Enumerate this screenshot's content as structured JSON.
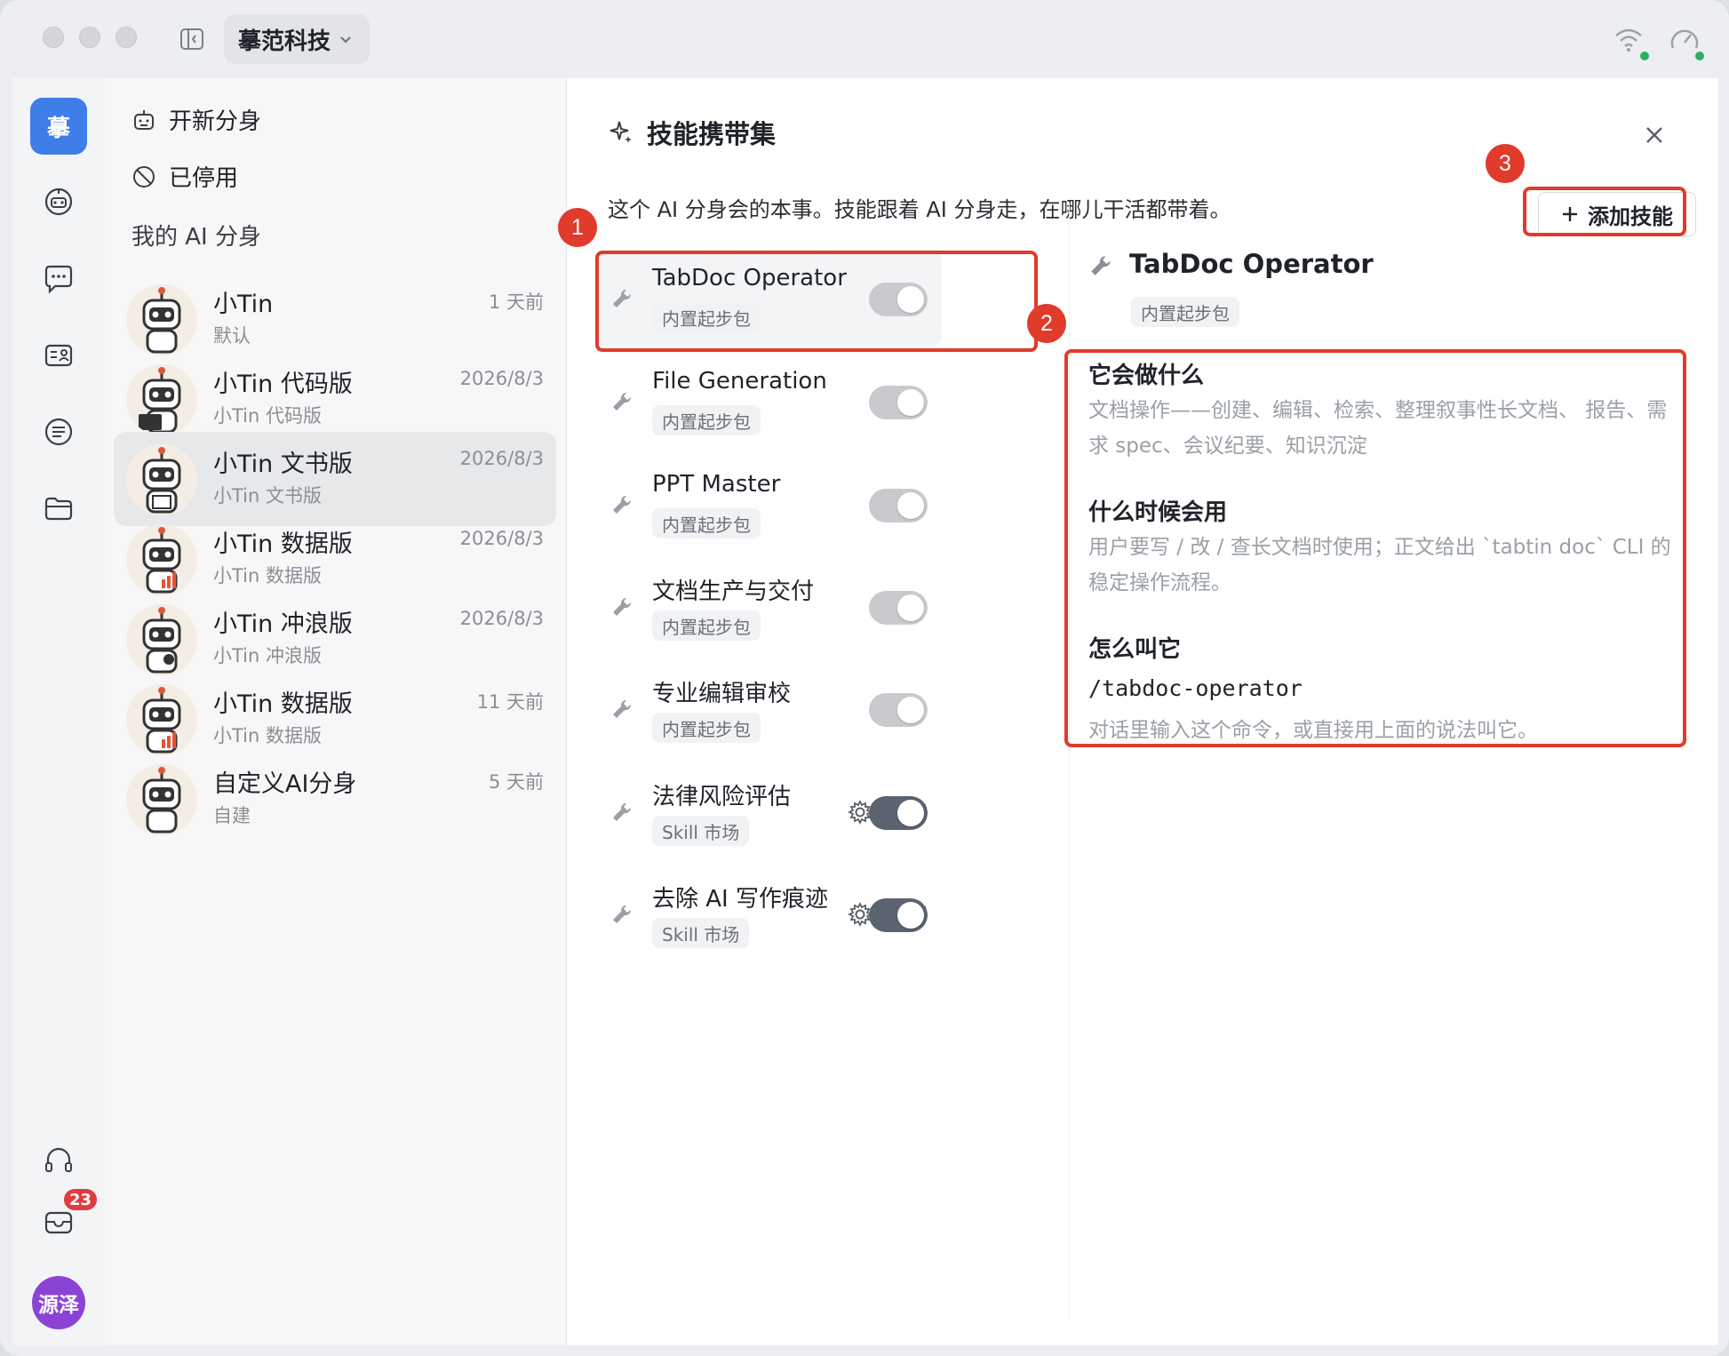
{
  "titlebar": {
    "workspace": "摹范科技"
  },
  "rail": {
    "logo_text": "摹",
    "mail_badge": "23",
    "user_avatar_text": "源泽"
  },
  "sidebar": {
    "new_agent": "开新分身",
    "disabled": "已停用",
    "section_title": "我的 AI 分身",
    "agents": [
      {
        "name": "小Tin",
        "sub": "默认",
        "time": "1 天前"
      },
      {
        "name": "小Tin 代码版",
        "sub": "小Tin 代码版",
        "time": "2026/8/3"
      },
      {
        "name": "小Tin 文书版",
        "sub": "小Tin 文书版",
        "time": "2026/8/3"
      },
      {
        "name": "小Tin 数据版",
        "sub": "小Tin 数据版",
        "time": "2026/8/3"
      },
      {
        "name": "小Tin 冲浪版",
        "sub": "小Tin 冲浪版",
        "time": "2026/8/3"
      },
      {
        "name": "小Tin 数据版",
        "sub": "小Tin 数据版",
        "time": "11 天前"
      },
      {
        "name": "自定义AI分身",
        "sub": "自建",
        "time": "5 天前"
      }
    ]
  },
  "panel": {
    "title": "技能携带集",
    "description": "这个 AI 分身会的本事。技能跟着 AI 分身走，在哪儿干活都带着。",
    "add_button": "添加技能",
    "skills": [
      {
        "name": "TabDoc Operator",
        "tag": "内置起步包",
        "enabled": true
      },
      {
        "name": "File Generation",
        "tag": "内置起步包",
        "enabled": true
      },
      {
        "name": "PPT Master",
        "tag": "内置起步包",
        "enabled": true
      },
      {
        "name": "文档生产与交付",
        "tag": "内置起步包",
        "enabled": true
      },
      {
        "name": "专业编辑审校",
        "tag": "内置起步包",
        "enabled": true
      },
      {
        "name": "法律风险评估",
        "tag": "Skill 市场",
        "enabled": true
      },
      {
        "name": "去除 AI 写作痕迹",
        "tag": "Skill 市场",
        "enabled": true
      }
    ],
    "detail": {
      "title": "TabDoc Operator",
      "tag": "内置起步包",
      "what_heading": "它会做什么",
      "what_text": "文档操作——创建、编辑、检索、整理叙事性长文档、 报告、需求 spec、会议纪要、知识沉淀",
      "when_heading": "什么时候会用",
      "when_text": "用户要写 / 改 / 查长文档时使用；正文给出 `tabtin doc` CLI 的稳定操作流程。",
      "how_heading": "怎么叫它",
      "command": "/tabdoc-operator",
      "how_text": "对话里输入这个命令，或直接用上面的说法叫它。"
    }
  },
  "annotations": {
    "marker_1": "1",
    "marker_2": "2",
    "marker_3": "3"
  },
  "colors": {
    "accent_blue": "#3f7de8",
    "annotation_red": "#e03b2b",
    "toggle_on": "#5b6270",
    "toggle_off": "#c8cace"
  }
}
